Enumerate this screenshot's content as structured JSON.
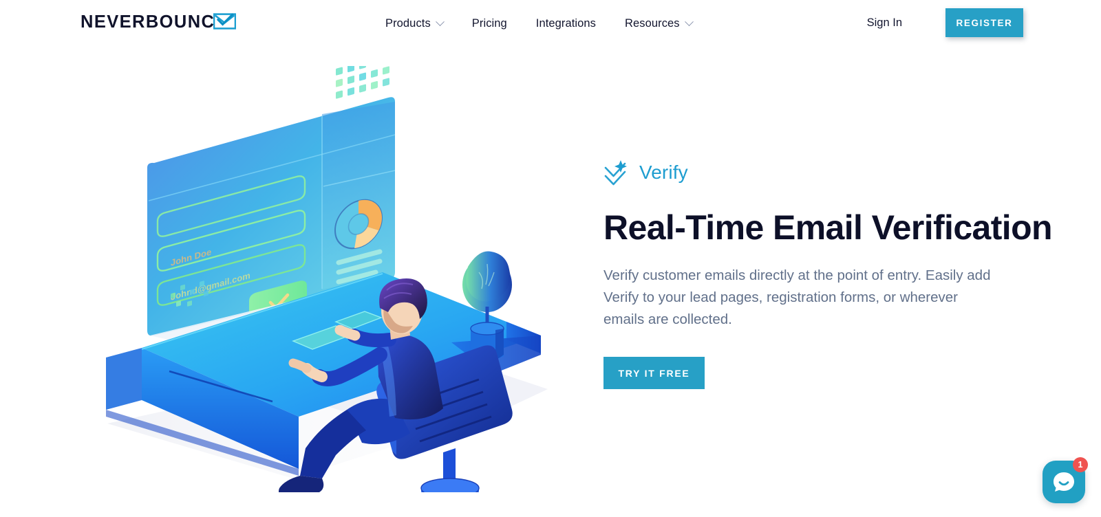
{
  "header": {
    "logo": {
      "text": "NEVERBOUNCE",
      "icon": "envelope-check-icon"
    },
    "nav": [
      {
        "label": "Products",
        "has_dropdown": true,
        "icon": "chevron-down-icon"
      },
      {
        "label": "Pricing",
        "has_dropdown": false
      },
      {
        "label": "Integrations",
        "has_dropdown": false
      },
      {
        "label": "Resources",
        "has_dropdown": true,
        "icon": "chevron-down-icon"
      }
    ],
    "sign_in_label": "Sign In",
    "register_label": "REGISTER"
  },
  "hero": {
    "eyebrow": {
      "label": "Verify",
      "icon": "sparkle-double-chevron-icon"
    },
    "title": "Real-Time Email Verification",
    "description": "Verify customer emails directly at the point of entry. Easily add Verify to your lead pages, registration forms, or wherever emails are collected.",
    "cta_label": "TRY IT FREE"
  },
  "illustration": {
    "name": "isometric-desk-email-verification",
    "screen": {
      "name_field_value": "John Doe",
      "email_field_value": "Johnd@gmail.com",
      "submit_icon": "checkmark-icon"
    },
    "widgets": {
      "dot_grid": "dot-grid",
      "donut_chart": "donut-chart",
      "bar_lines": "bar-lines"
    },
    "objects": [
      "monitor",
      "desk",
      "person-seated",
      "office-chair",
      "potted-plant",
      "keyboard",
      "trackpad"
    ]
  },
  "chat": {
    "icon": "chat-smiley-icon",
    "unread_count": "1"
  },
  "colors": {
    "accent_teal": "#27a0c6",
    "eyebrow_blue": "#1e9dd0",
    "heading_navy": "#0d1028",
    "body_gray": "#61708a",
    "badge_red": "#ef5350",
    "page_bg": "#ffffff"
  }
}
